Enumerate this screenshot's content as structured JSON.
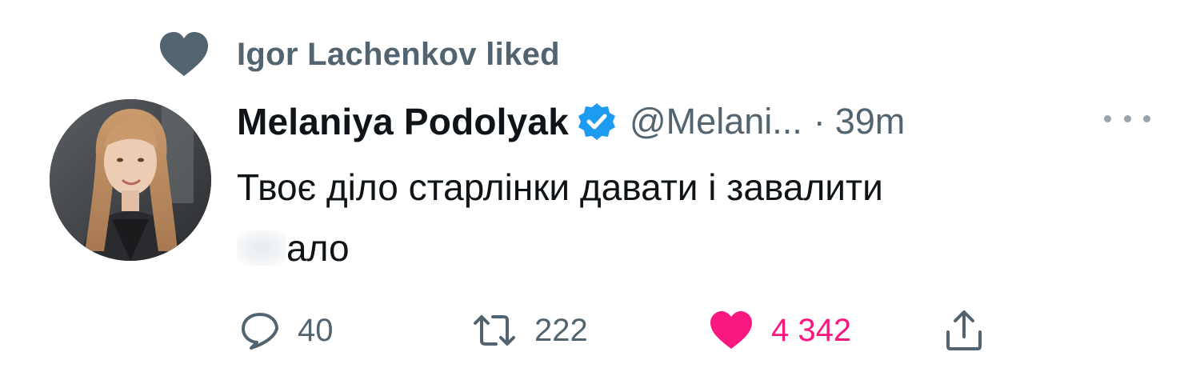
{
  "social_context": {
    "icon": "heart-icon",
    "text": "Igor Lachenkov liked"
  },
  "tweet": {
    "display_name": "Melaniya Podolyak",
    "verified_icon": "verified-badge-icon",
    "handle": "@Melani...",
    "separator": "·",
    "time": "39m",
    "text_before_redaction": "Твоє діло старлінки давати і завалити ",
    "text_after_redaction": "ало"
  },
  "actions": {
    "reply": {
      "icon": "reply-icon",
      "count": "40"
    },
    "retweet": {
      "icon": "retweet-icon",
      "count": "222"
    },
    "like": {
      "icon": "heart-filled-icon",
      "count": "4 342",
      "color": "#f91880"
    },
    "share": {
      "icon": "share-icon"
    }
  },
  "colors": {
    "secondary_text": "#536471",
    "primary_text": "#0f1419",
    "verified_blue": "#1d9bf0",
    "like_pink": "#f91880"
  }
}
